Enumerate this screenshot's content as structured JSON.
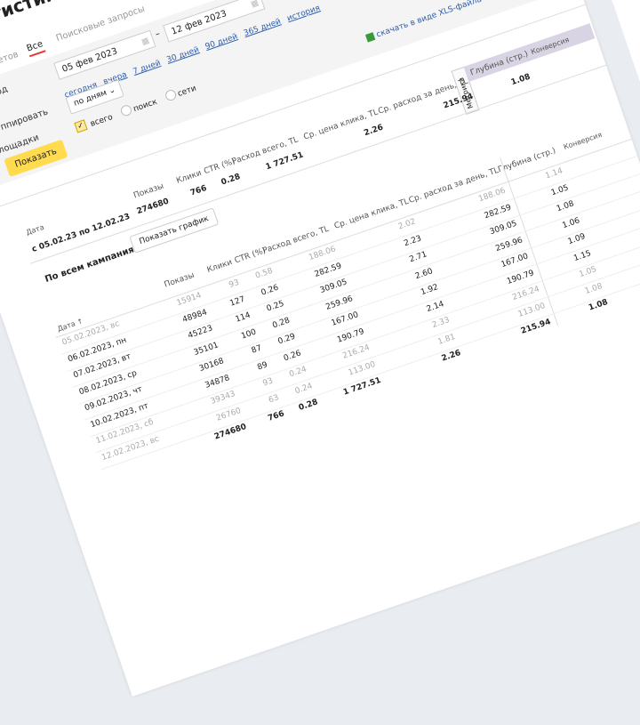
{
  "header": {
    "title": "Статистика по всем кампаниям"
  },
  "tabs": [
    {
      "label": "Мастер отчетов"
    },
    {
      "label": "Все"
    },
    {
      "label": "Поисковые запросы"
    }
  ],
  "filters": {
    "period_label": "Период",
    "date_from": "05 фев 2023",
    "date_to": "12 фев 2023",
    "date_sep": "–",
    "quick_links": [
      "сегодня",
      "вчера",
      "7 дней",
      "30 дней",
      "90 дней",
      "365 дней",
      "история"
    ],
    "group_label": "Группировать",
    "group_value": "по дням",
    "places_label": "Площадки",
    "places_options": [
      "всего",
      "поиск",
      "сети"
    ],
    "show_button": "Показать",
    "xls_link": "скачать в виде XLS-файла"
  },
  "summary": {
    "headers": {
      "date": "Дата",
      "impressions": "Показы",
      "clicks": "Клики",
      "ctr": "CTR (%)",
      "spend": "Расход всего, TL",
      "cpc": "Ср. цена клика, TL",
      "daily": "Ср. расход за день, TL",
      "metrika": "Метрика",
      "depth": "Глубина (стр.)",
      "conv": "Конверсия"
    },
    "date": "с 05.02.23 по 12.02.23",
    "impressions": "274680",
    "clicks": "766",
    "ctr": "0.28",
    "spend": "1 727.51",
    "cpc": "2.26",
    "daily": "215.94",
    "depth": "1.08"
  },
  "campaigns": {
    "title": "По всем кампаниям",
    "chart_button": "Показать график",
    "headers": {
      "date": "Дата ↑",
      "impressions": "Показы",
      "clicks": "Клики",
      "ctr": "CTR (%)",
      "spend": "Расход всего, TL",
      "cpc": "Ср. цена клика, TL",
      "daily": "Ср. расход за день, TL",
      "depth": "Глубина (стр.)",
      "conv": "Конверсия"
    },
    "rows": [
      {
        "date": "05.02.2023, вс",
        "weekend": true,
        "impressions": "15914",
        "clicks": "93",
        "ctr": "0.58",
        "spend": "188.06",
        "cpc": "2.02",
        "daily": "188.06",
        "depth": "1.14"
      },
      {
        "date": "06.02.2023, пн",
        "weekend": false,
        "impressions": "48984",
        "clicks": "127",
        "ctr": "0.26",
        "spend": "282.59",
        "cpc": "2.23",
        "daily": "282.59",
        "depth": "1.05"
      },
      {
        "date": "07.02.2023, вт",
        "weekend": false,
        "impressions": "45223",
        "clicks": "114",
        "ctr": "0.25",
        "spend": "309.05",
        "cpc": "2.71",
        "daily": "309.05",
        "depth": "1.08"
      },
      {
        "date": "08.02.2023, ср",
        "weekend": false,
        "impressions": "35101",
        "clicks": "100",
        "ctr": "0.28",
        "spend": "259.96",
        "cpc": "2.60",
        "daily": "259.96",
        "depth": "1.06"
      },
      {
        "date": "09.02.2023, чт",
        "weekend": false,
        "impressions": "30168",
        "clicks": "87",
        "ctr": "0.29",
        "spend": "167.00",
        "cpc": "1.92",
        "daily": "167.00",
        "depth": "1.09"
      },
      {
        "date": "10.02.2023, пт",
        "weekend": false,
        "impressions": "34878",
        "clicks": "89",
        "ctr": "0.26",
        "spend": "190.79",
        "cpc": "2.14",
        "daily": "190.79",
        "depth": "1.15"
      },
      {
        "date": "11.02.2023, сб",
        "weekend": true,
        "impressions": "39343",
        "clicks": "93",
        "ctr": "0.24",
        "spend": "216.24",
        "cpc": "2.33",
        "daily": "216.24",
        "depth": "1.05"
      },
      {
        "date": "12.02.2023, вс",
        "weekend": true,
        "impressions": "26760",
        "clicks": "63",
        "ctr": "0.24",
        "spend": "113.00",
        "cpc": "1.81",
        "daily": "113.00",
        "depth": "1.08"
      }
    ],
    "totals": {
      "impressions": "274680",
      "clicks": "766",
      "ctr": "0.28",
      "spend": "1 727.51",
      "cpc": "2.26",
      "daily": "215.94",
      "depth": "1.08"
    }
  },
  "colors": {
    "accent_button": "#ffdb4d",
    "link": "#2a5db0",
    "tab_underline": "#ee3333"
  }
}
